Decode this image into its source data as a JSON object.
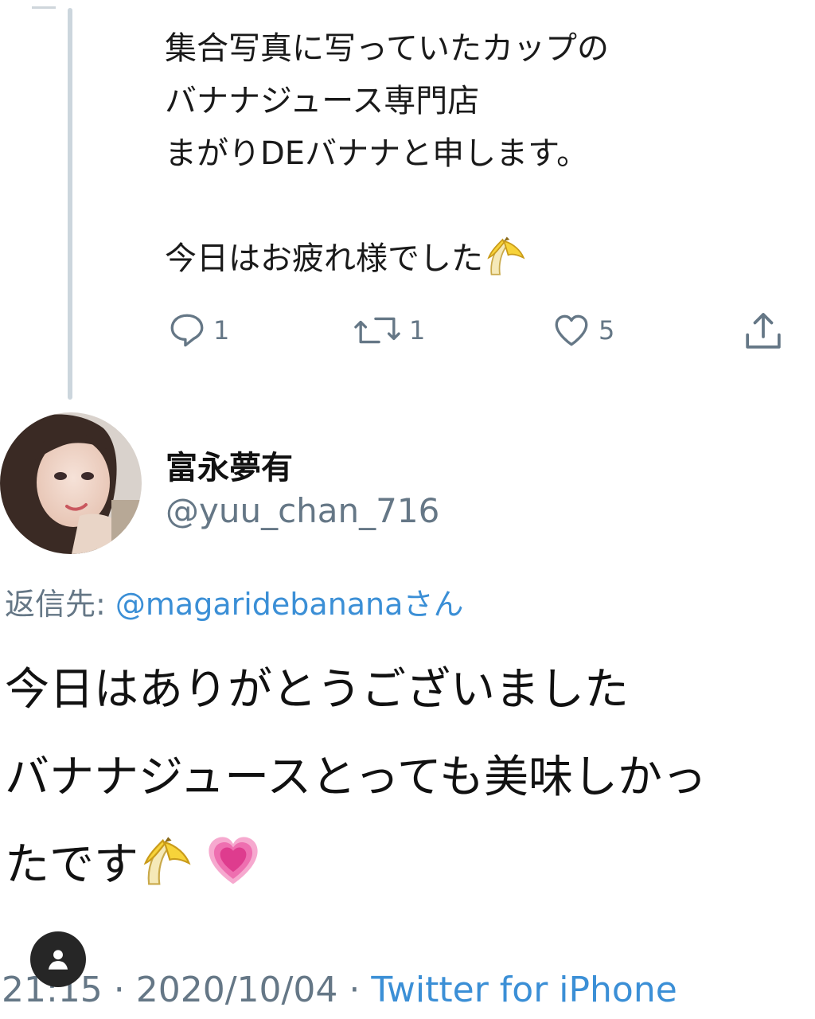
{
  "parent_tweet": {
    "text": "集合写真に写っていたカップの\nバナナジュース専門店\nまがりDEバナナと申します。\n\n今日はお疲れ様でした",
    "emoji": "banana",
    "actions": {
      "reply_count": "1",
      "retweet_count": "1",
      "like_count": "5"
    }
  },
  "reply_tweet": {
    "display_name": "富永夢有",
    "handle": "@yuu_chan_716",
    "reply_to_prefix": "返信先: ",
    "reply_to_mention": "@magaridebanana",
    "reply_to_suffix": "さん",
    "text_lines": [
      "今日はありがとうございました",
      "バナナジュースとっても美味しかっ",
      "たです"
    ],
    "emojis": [
      "banana",
      "growing-heart"
    ],
    "meta_time": "21:15 · 2020/10/04 · ",
    "meta_source": "Twitter for iPhone"
  },
  "colors": {
    "muted": "#657786",
    "link": "#3b8fd6",
    "thread_line": "#ccd6dd"
  }
}
